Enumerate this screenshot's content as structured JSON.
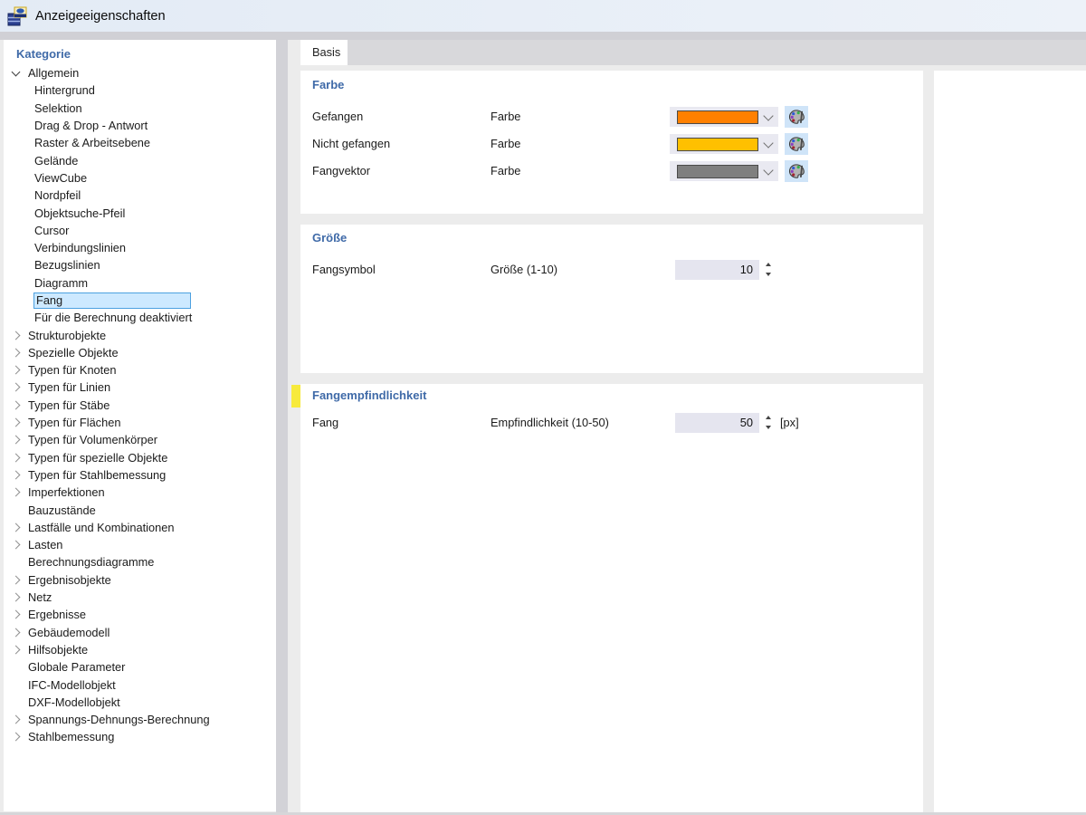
{
  "window": {
    "title": "Anzeigeeigenschaften",
    "icon": "display-properties-icon"
  },
  "sidebar": {
    "header": "Kategorie",
    "items": [
      {
        "label": "Allgemein",
        "level": 0,
        "state": "expanded",
        "selected": false
      },
      {
        "label": "Hintergrund",
        "level": 1,
        "state": "none",
        "selected": false
      },
      {
        "label": "Selektion",
        "level": 1,
        "state": "none",
        "selected": false
      },
      {
        "label": "Drag & Drop - Antwort",
        "level": 1,
        "state": "none",
        "selected": false
      },
      {
        "label": "Raster & Arbeitsebene",
        "level": 1,
        "state": "none",
        "selected": false
      },
      {
        "label": "Gelände",
        "level": 1,
        "state": "none",
        "selected": false
      },
      {
        "label": "ViewCube",
        "level": 1,
        "state": "none",
        "selected": false
      },
      {
        "label": "Nordpfeil",
        "level": 1,
        "state": "none",
        "selected": false
      },
      {
        "label": "Objektsuche-Pfeil",
        "level": 1,
        "state": "none",
        "selected": false
      },
      {
        "label": "Cursor",
        "level": 1,
        "state": "none",
        "selected": false
      },
      {
        "label": "Verbindungslinien",
        "level": 1,
        "state": "none",
        "selected": false
      },
      {
        "label": "Bezugslinien",
        "level": 1,
        "state": "none",
        "selected": false
      },
      {
        "label": "Diagramm",
        "level": 1,
        "state": "none",
        "selected": false
      },
      {
        "label": "Fang",
        "level": 1,
        "state": "none",
        "selected": true
      },
      {
        "label": "Für die Berechnung deaktiviert",
        "level": 1,
        "state": "none",
        "selected": false
      },
      {
        "label": "Strukturobjekte",
        "level": 0,
        "state": "collapsed",
        "selected": false
      },
      {
        "label": "Spezielle Objekte",
        "level": 0,
        "state": "collapsed",
        "selected": false
      },
      {
        "label": "Typen für Knoten",
        "level": 0,
        "state": "collapsed",
        "selected": false
      },
      {
        "label": "Typen für Linien",
        "level": 0,
        "state": "collapsed",
        "selected": false
      },
      {
        "label": "Typen für Stäbe",
        "level": 0,
        "state": "collapsed",
        "selected": false
      },
      {
        "label": "Typen für Flächen",
        "level": 0,
        "state": "collapsed",
        "selected": false
      },
      {
        "label": "Typen für Volumenkörper",
        "level": 0,
        "state": "collapsed",
        "selected": false
      },
      {
        "label": "Typen für spezielle Objekte",
        "level": 0,
        "state": "collapsed",
        "selected": false
      },
      {
        "label": "Typen für Stahlbemessung",
        "level": 0,
        "state": "collapsed",
        "selected": false
      },
      {
        "label": "Imperfektionen",
        "level": 0,
        "state": "collapsed",
        "selected": false
      },
      {
        "label": "Bauzustände",
        "level": 0,
        "state": "none",
        "selected": false
      },
      {
        "label": "Lastfälle und Kombinationen",
        "level": 0,
        "state": "collapsed",
        "selected": false
      },
      {
        "label": "Lasten",
        "level": 0,
        "state": "collapsed",
        "selected": false
      },
      {
        "label": "Berechnungsdiagramme",
        "level": 0,
        "state": "none",
        "selected": false
      },
      {
        "label": "Ergebnisobjekte",
        "level": 0,
        "state": "collapsed",
        "selected": false
      },
      {
        "label": "Netz",
        "level": 0,
        "state": "collapsed",
        "selected": false
      },
      {
        "label": "Ergebnisse",
        "level": 0,
        "state": "collapsed",
        "selected": false
      },
      {
        "label": "Gebäudemodell",
        "level": 0,
        "state": "collapsed",
        "selected": false
      },
      {
        "label": "Hilfsobjekte",
        "level": 0,
        "state": "collapsed",
        "selected": false
      },
      {
        "label": "Globale Parameter",
        "level": 0,
        "state": "none",
        "selected": false
      },
      {
        "label": "IFC-Modellobjekt",
        "level": 0,
        "state": "none",
        "selected": false
      },
      {
        "label": "DXF-Modellobjekt",
        "level": 0,
        "state": "none",
        "selected": false
      },
      {
        "label": "Spannungs-Dehnungs-Berechnung",
        "level": 0,
        "state": "collapsed",
        "selected": false
      },
      {
        "label": "Stahlbemessung",
        "level": 0,
        "state": "collapsed",
        "selected": false
      }
    ]
  },
  "tabs": [
    {
      "label": "Basis",
      "active": true
    }
  ],
  "sections": [
    {
      "title": "Farbe",
      "highlighted": false,
      "rows": [
        {
          "label": "Gefangen",
          "param": "Farbe",
          "control": "color",
          "color": "#FF8000"
        },
        {
          "label": "Nicht gefangen",
          "param": "Farbe",
          "control": "color",
          "color": "#FFC000"
        },
        {
          "label": "Fangvektor",
          "param": "Farbe",
          "control": "color",
          "color": "#7F7F7F"
        }
      ]
    },
    {
      "title": "Größe",
      "highlighted": false,
      "rows": [
        {
          "label": "Fangsymbol",
          "param": "Größe (1-10)",
          "control": "spinner",
          "value": "10",
          "unit": ""
        }
      ]
    },
    {
      "title": "Fangempfindlichkeit",
      "highlighted": true,
      "rows": [
        {
          "label": "Fang",
          "param": "Empfindlichkeit (10-50)",
          "control": "spinner",
          "value": "50",
          "unit": "[px]"
        }
      ]
    }
  ],
  "colors": {
    "header_accent": "#3F6AA8",
    "selection_bg": "#CDE9FF",
    "selection_border": "#4DA1E0",
    "highlight_marker": "#F7EA3C",
    "titlebar_bg": "#E9EFF7",
    "swatch_orange": "#FF8000",
    "swatch_gold": "#FFC000",
    "swatch_gray": "#7F7F7F"
  }
}
